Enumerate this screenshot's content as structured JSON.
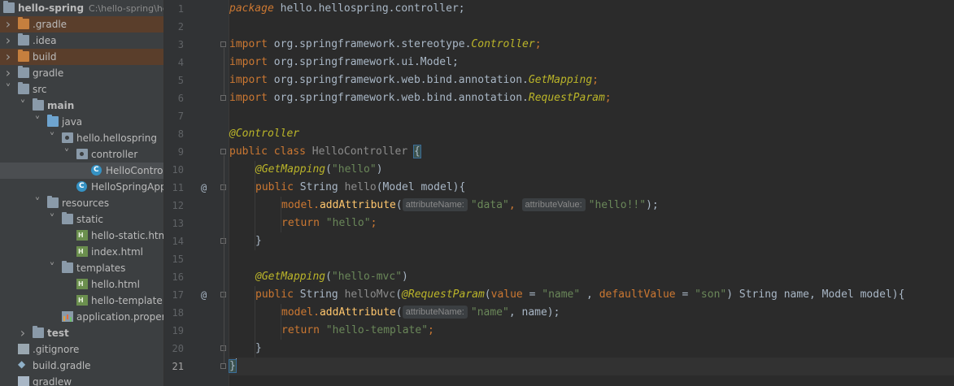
{
  "project_tree": {
    "root": {
      "name": "hello-spring",
      "path": "C:\\hello-spring\\he"
    },
    "items": [
      {
        "label": ".gradle",
        "icon": "folder-icon",
        "expanded": false,
        "depth": 0,
        "excluded": true
      },
      {
        "label": ".idea",
        "icon": "folder-icon",
        "expanded": false,
        "depth": 0
      },
      {
        "label": "build",
        "icon": "folder-icon",
        "expanded": false,
        "depth": 0,
        "excluded": true
      },
      {
        "label": "gradle",
        "icon": "folder-icon",
        "expanded": false,
        "depth": 0
      },
      {
        "label": "src",
        "icon": "folder-icon",
        "expanded": true,
        "depth": 0
      },
      {
        "label": "main",
        "icon": "folder-icon",
        "expanded": true,
        "depth": 1,
        "bold": true
      },
      {
        "label": "java",
        "icon": "source-folder-icon",
        "expanded": true,
        "depth": 2
      },
      {
        "label": "hello.hellospring",
        "icon": "package-icon",
        "expanded": true,
        "depth": 3
      },
      {
        "label": "controller",
        "icon": "package-icon",
        "expanded": true,
        "depth": 4
      },
      {
        "label": "HelloControll",
        "icon": "java-class-icon",
        "depth": 5,
        "selected": true
      },
      {
        "label": "HelloSpringAppli",
        "icon": "spring-boot-class-icon",
        "depth": 4
      },
      {
        "label": "resources",
        "icon": "resources-folder-icon",
        "expanded": true,
        "depth": 2
      },
      {
        "label": "static",
        "icon": "folder-icon",
        "expanded": true,
        "depth": 3
      },
      {
        "label": "hello-static.html",
        "icon": "html-file-icon",
        "depth": 4
      },
      {
        "label": "index.html",
        "icon": "html-file-icon",
        "depth": 4
      },
      {
        "label": "templates",
        "icon": "folder-icon",
        "expanded": true,
        "depth": 3
      },
      {
        "label": "hello.html",
        "icon": "html-file-icon",
        "depth": 4
      },
      {
        "label": "hello-template.ht",
        "icon": "html-file-icon",
        "depth": 4
      },
      {
        "label": "application.propertie",
        "icon": "properties-file-icon",
        "depth": 3
      },
      {
        "label": "test",
        "icon": "folder-icon",
        "expanded": false,
        "depth": 1,
        "bold": true
      },
      {
        "label": ".gitignore",
        "icon": "gitignore-file-icon",
        "depth": 0
      },
      {
        "label": "build.gradle",
        "icon": "gradle-file-icon",
        "depth": 0
      },
      {
        "label": "gradlew",
        "icon": "file-icon",
        "depth": 0
      }
    ]
  },
  "editor": {
    "current_line": 21,
    "line_numbers": [
      "1",
      "2",
      "3",
      "4",
      "5",
      "6",
      "7",
      "8",
      "9",
      "10",
      "11",
      "12",
      "13",
      "14",
      "15",
      "16",
      "17",
      "18",
      "19",
      "20",
      "21"
    ],
    "code": {
      "l1_kw": "package",
      "l1_rest": " hello.hellospring.controller;",
      "l3_kw": "import",
      "l3_pre": " org.springframework.stereotype.",
      "l3_cls": "Controller",
      "l3_end": ";",
      "l4_kw": "import",
      "l4_rest": " org.springframework.ui.Model;",
      "l5_kw": "import",
      "l5_pre": " org.springframework.web.bind.annotation.",
      "l5_cls": "GetMapping",
      "l5_end": ";",
      "l6_kw": "import",
      "l6_pre": " org.springframework.web.bind.annotation.",
      "l6_cls": "RequestParam",
      "l6_end": ";",
      "l8_ann": "@Controller",
      "l9_kw": "public class",
      "l9_name": " HelloController ",
      "l9_brace": "{",
      "l10_ann": "@GetMapping",
      "l10_open": "(",
      "l10_str": "\"hello\"",
      "l10_close": ")",
      "l11_kw": "public",
      "l11_type": " String ",
      "l11_name": "hello",
      "l11_args": "(Model model){",
      "l12_obj": "model.",
      "l12_call": "addAttribute",
      "l12_open": "(",
      "l12_hint1": "attributeName:",
      "l12_str1": "\"data\"",
      "l12_comma": ", ",
      "l12_hint2": "attributeValue:",
      "l12_str2": "\"hello!!\"",
      "l12_end": ");",
      "l13_kw": "return",
      "l13_str": " \"hello\"",
      "l13_end": ";",
      "l14": "}",
      "l16_ann": "@GetMapping",
      "l16_open": "(",
      "l16_str": "\"hello-mvc\"",
      "l16_close": ")",
      "l17_kw": "public",
      "l17_type": " String ",
      "l17_name": "helloMvc",
      "l17_open": "(",
      "l17_ann": "@RequestParam",
      "l17_p1": "(",
      "l17_value_kw": "value",
      "l17_eq1": " = ",
      "l17_str1": "\"name\"",
      "l17_sep": " , ",
      "l17_default_kw": "defaultValue",
      "l17_eq2": " = ",
      "l17_str2": "\"son\"",
      "l17_rest": ") String name, Model model){",
      "l18_obj": "model.",
      "l18_call": "addAttribute",
      "l18_open": "(",
      "l18_hint1": "attributeName:",
      "l18_str1": "\"name\"",
      "l18_rest": ", name);",
      "l19_kw": "return",
      "l19_str": " \"hello-template\"",
      "l19_end": ";",
      "l20": "}",
      "l21": "}"
    },
    "gutter_markers": {
      "l11": "@",
      "l17": "@"
    }
  },
  "colors": {
    "keyword": "#cc7832",
    "annotation": "#bbb529",
    "string": "#6a8759",
    "method": "#ffc66d",
    "text": "#a9b7c6",
    "background": "#2b2b2b",
    "sidebar": "#3c3f41"
  }
}
